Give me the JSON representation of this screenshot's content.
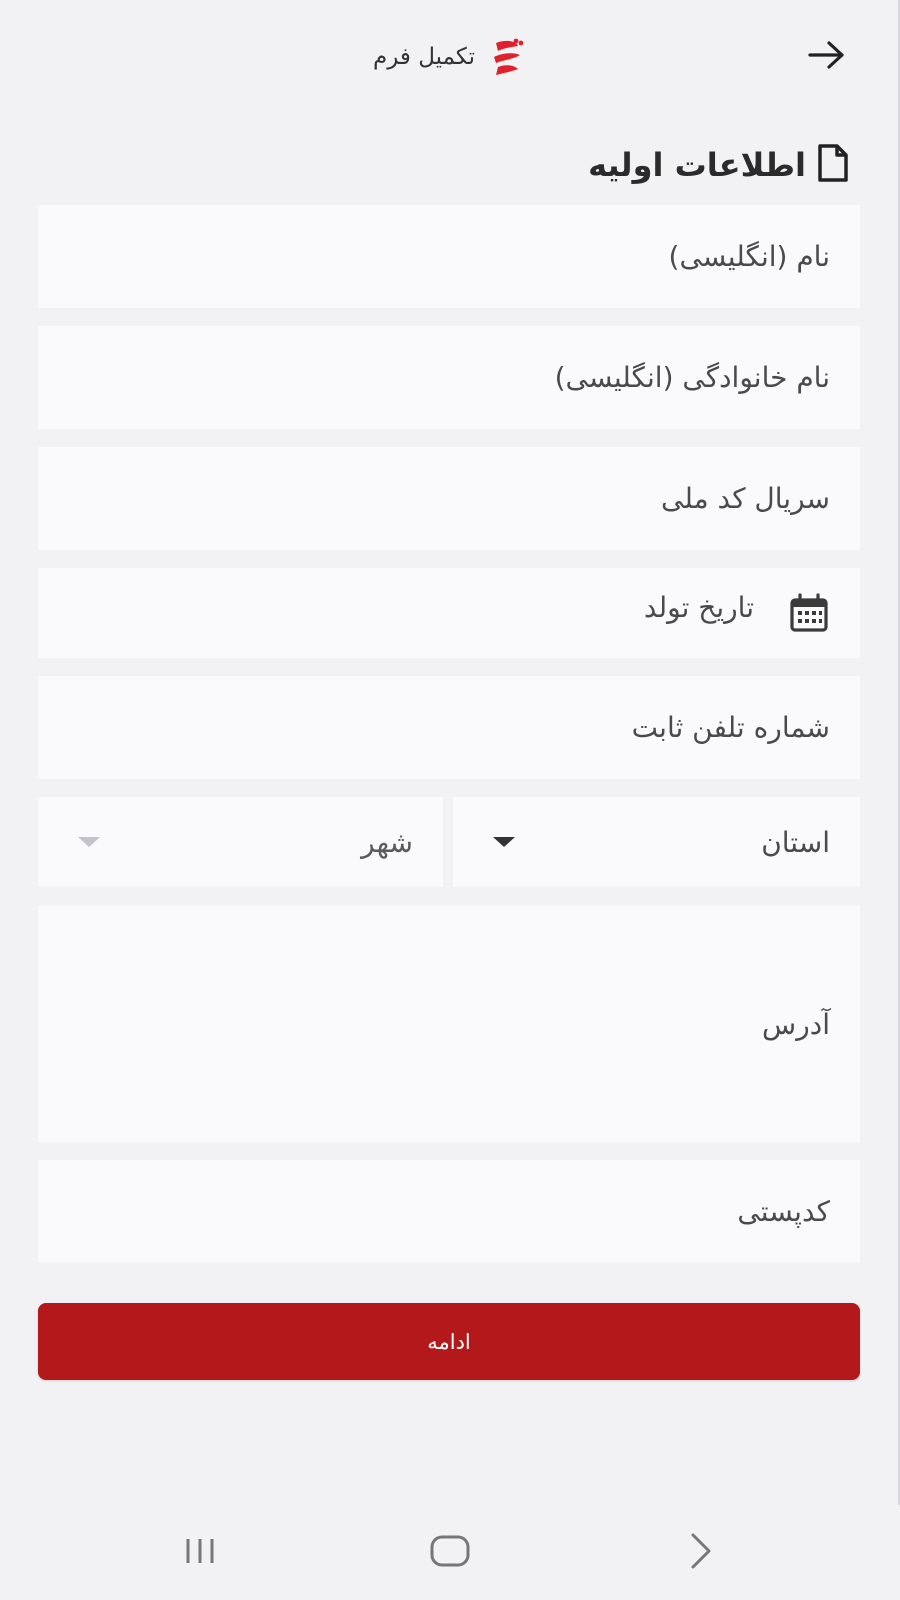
{
  "header": {
    "title": "تکمیل فرم",
    "back_icon": "arrow-right-icon",
    "logo_icon": "brand-logo-icon",
    "brand_color": "#e0212c"
  },
  "section": {
    "title": "اطلاعات اولیه",
    "icon": "document-icon"
  },
  "form": {
    "first_name_en": "نام (انگلیسی)",
    "last_name_en": "نام خانوادگی (انگلیسی)",
    "national_card_serial": "سریال کد ملی",
    "birth_date": "تاریخ تولد",
    "landline": "شماره تلفن ثابت",
    "province": "استان",
    "city": "شهر",
    "address": "آدرس",
    "postal_code": "کدپستی"
  },
  "actions": {
    "continue_label": "ادامه",
    "accent_color": "#b3191a"
  },
  "system_nav": {
    "recents_icon": "recents-icon",
    "home_icon": "home-icon",
    "back_icon": "chevron-back-icon"
  }
}
